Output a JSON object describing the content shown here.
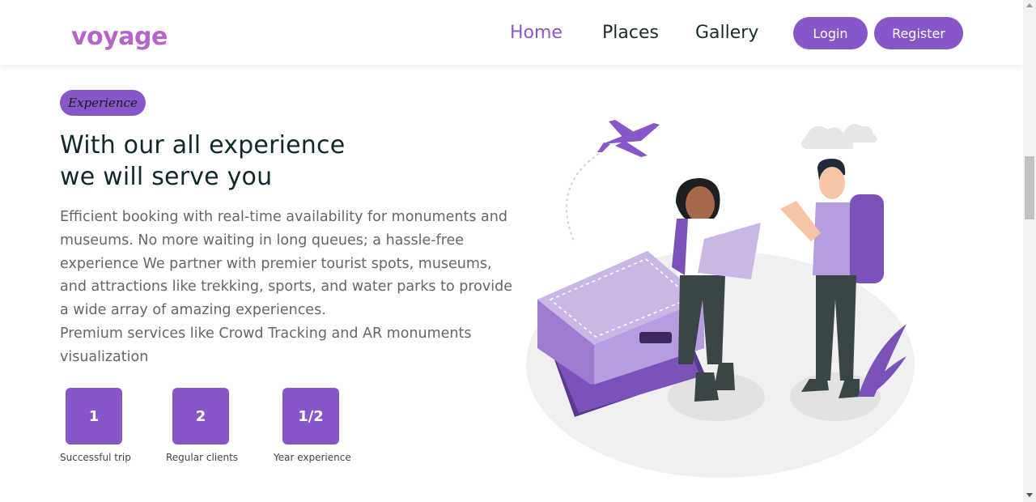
{
  "header": {
    "logo": "voyage",
    "nav": [
      "Home",
      "Places",
      "Gallery"
    ],
    "login_label": "Login",
    "register_label": "Register"
  },
  "hero": {
    "badge": "Experience",
    "headline_line1": "With our all experience",
    "headline_line2": "we will serve you",
    "description_p1": "Efficient booking with real-time availability for monuments and museums. No more waiting in long queues; a hassle-free experience We partner with premier tourist spots, museums, and attractions like trekking, sports, and water parks to provide a wide array of amazing experiences.",
    "description_p2": "Premium services like Crowd Tracking and AR monuments visualization"
  },
  "stats": [
    {
      "value": "1",
      "label": "Successful trip"
    },
    {
      "value": "2",
      "label": "Regular clients"
    },
    {
      "value": "1/2",
      "label": "Year experience"
    }
  ],
  "colors": {
    "accent": "#8756c9",
    "logo": "#b565c9",
    "heading": "#10282a",
    "body_text": "#666666"
  }
}
